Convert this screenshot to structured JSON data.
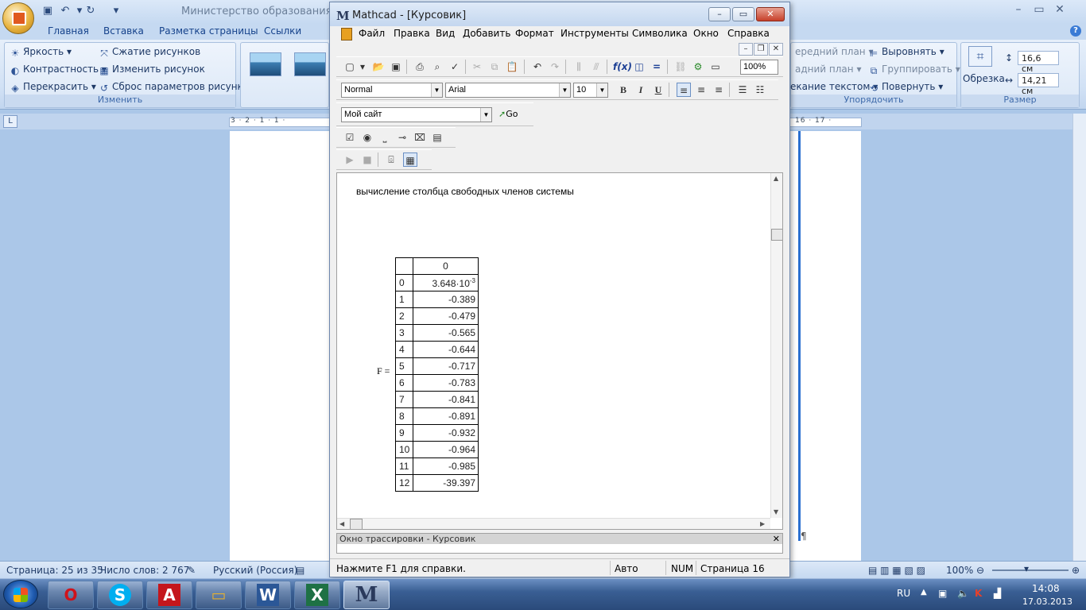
{
  "word": {
    "doc_title": "Министерство образования и нау",
    "tabs": [
      "Главная",
      "Вставка",
      "Разметка страницы",
      "Ссылки"
    ],
    "ribbon": {
      "adjust": {
        "items": [
          "Яркость",
          "Контрастность",
          "Перекрасить",
          "Сжатие рисунков",
          "Изменить рисунок",
          "Сброс параметров рисунка"
        ],
        "label": "Изменить"
      },
      "arrange": {
        "items": [
          "ередний план",
          "адний план",
          "екание текстом",
          "Выровнять",
          "Группировать",
          "Повернуть"
        ],
        "label": "Упорядочить"
      },
      "size": {
        "crop": "Обрезка",
        "height": "16,6 см",
        "width": "14,21 см",
        "label": "Размер"
      }
    },
    "ruler_left": "3 · 2 · 1 · 1 ·",
    "ruler_right": "16 · 17 ·",
    "status": {
      "page": "Страница: 25 из 35",
      "words": "Число слов: 2 767",
      "language": "Русский (Россия)",
      "zoom": "100%"
    }
  },
  "mathcad": {
    "title": "Mathcad - [Курсовик]",
    "menu": [
      "Файл",
      "Правка",
      "Вид",
      "Добавить",
      "Формат",
      "Инструменты",
      "Символика",
      "Окно",
      "Справка"
    ],
    "zoom": "100%",
    "style": "Normal",
    "font": "Arial",
    "size": "10",
    "resource": "Мой сайт",
    "go": "Go",
    "heading": "вычисление столбца свободных членов системы",
    "matrix": {
      "name": "F =",
      "header": "0",
      "rows": [
        {
          "index": "0",
          "mantissa": "3.648",
          "times": "·10",
          "exp": "-3"
        },
        {
          "index": "1",
          "value": "-0.389"
        },
        {
          "index": "2",
          "value": "-0.479"
        },
        {
          "index": "3",
          "value": "-0.565"
        },
        {
          "index": "4",
          "value": "-0.644"
        },
        {
          "index": "5",
          "value": "-0.717"
        },
        {
          "index": "6",
          "value": "-0.783"
        },
        {
          "index": "7",
          "value": "-0.841"
        },
        {
          "index": "8",
          "value": "-0.891"
        },
        {
          "index": "9",
          "value": "-0.932"
        },
        {
          "index": "10",
          "value": "-0.964"
        },
        {
          "index": "11",
          "value": "-0.985"
        },
        {
          "index": "12",
          "value": "-39.397"
        }
      ]
    },
    "trace_title": "Окно трассировки - Курсовик",
    "status": {
      "help": "Нажмите F1 для справки.",
      "mode": "Авто",
      "num": "NUM",
      "page": "Страница 16"
    }
  },
  "taskbar": {
    "lang": "RU",
    "time": "14:08",
    "date": "17.03.2013"
  }
}
